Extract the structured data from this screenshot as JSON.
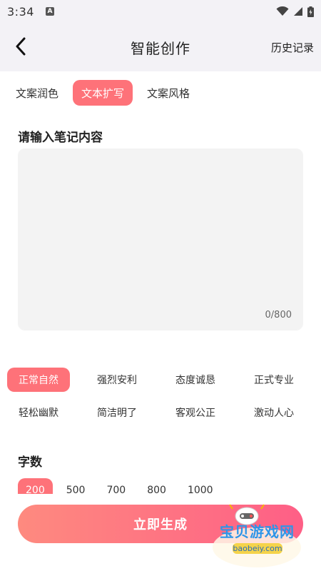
{
  "status": {
    "time": "3:34",
    "a_label": "A"
  },
  "header": {
    "title": "智能创作",
    "history_label": "历史记录"
  },
  "tabs": [
    {
      "label": "文案润色",
      "active": false
    },
    {
      "label": "文本扩写",
      "active": true
    },
    {
      "label": "文案风格",
      "active": false
    }
  ],
  "content": {
    "label": "请输入笔记内容",
    "value": "",
    "placeholder": "",
    "char_count": "0/800"
  },
  "styles": [
    {
      "label": "正常自然",
      "active": true
    },
    {
      "label": "强烈安利",
      "active": false
    },
    {
      "label": "态度诚恳",
      "active": false
    },
    {
      "label": "正式专业",
      "active": false
    },
    {
      "label": "轻松幽默",
      "active": false
    },
    {
      "label": "简洁明了",
      "active": false
    },
    {
      "label": "客观公正",
      "active": false
    },
    {
      "label": "激动人心",
      "active": false
    }
  ],
  "word_count": {
    "label": "字数",
    "options": [
      {
        "label": "200",
        "active": true
      },
      {
        "label": "500",
        "active": false
      },
      {
        "label": "700",
        "active": false
      },
      {
        "label": "800",
        "active": false
      },
      {
        "label": "1000",
        "active": false
      }
    ]
  },
  "generate_label": "立即生成",
  "watermark": {
    "text": "宝贝游戏网",
    "url": "baobeiy.com"
  },
  "colors": {
    "accent": "#fe7279",
    "button_start": "#fe8a7f",
    "button_end": "#fe5f86",
    "header_bg": "#f3f2f6"
  },
  "icons": {
    "back": "chevron-left-icon",
    "wifi": "wifi-icon",
    "signal": "signal-icon",
    "battery": "battery-icon"
  }
}
